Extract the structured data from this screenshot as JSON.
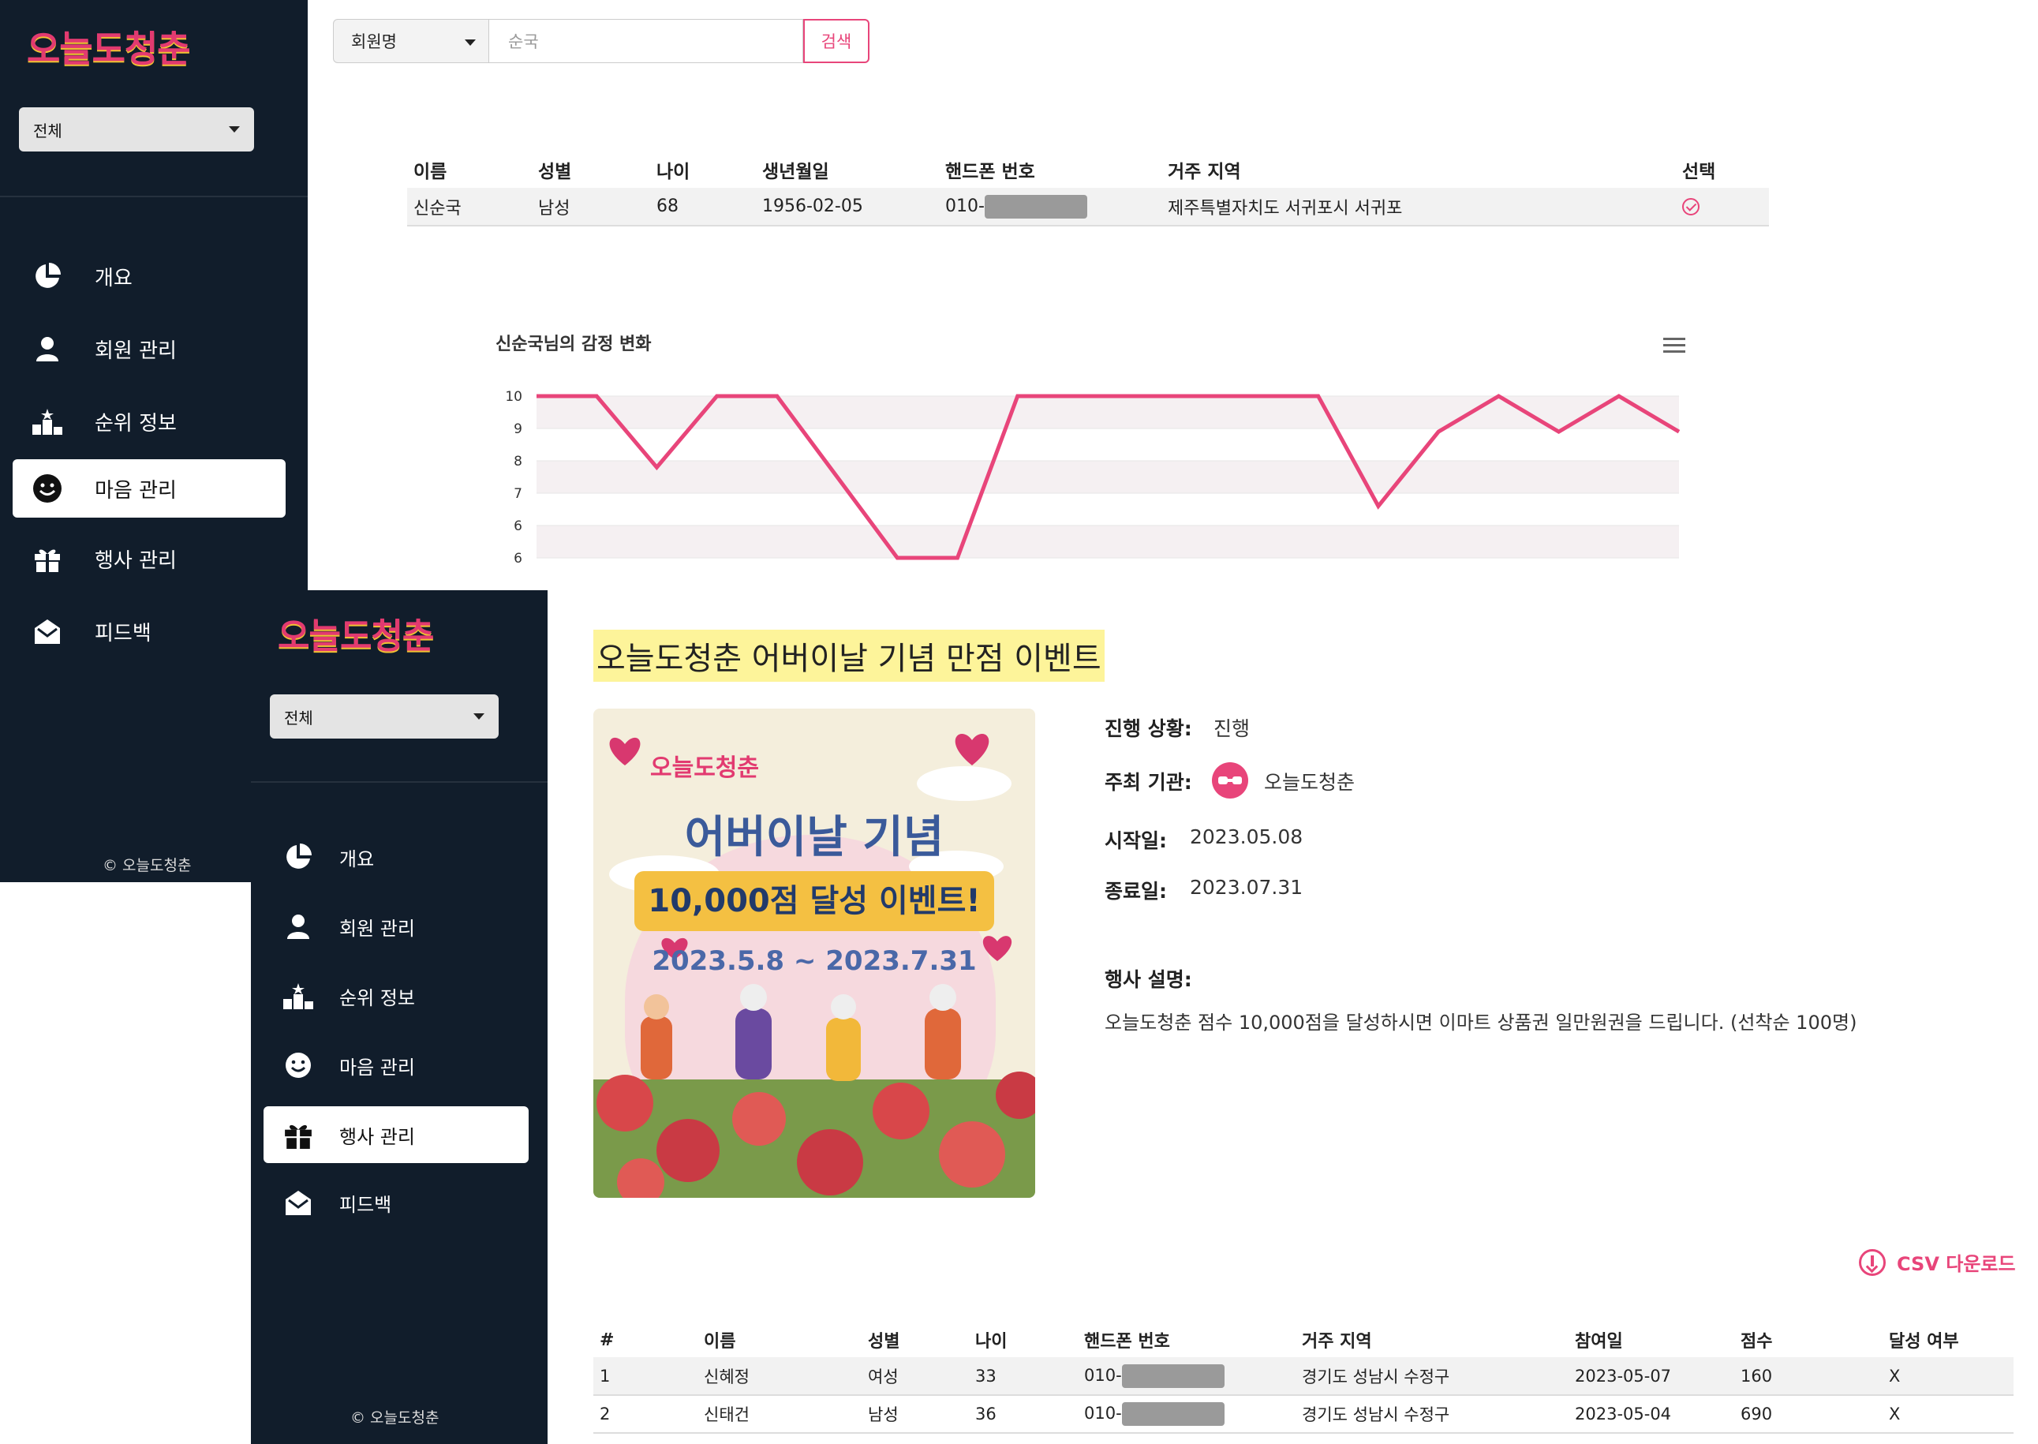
{
  "brand": {
    "logo_text": "오늘도청춘",
    "footer": "© 오늘도청춘",
    "accent": "#e8457a"
  },
  "sidebar": {
    "filter_value": "전체",
    "items": [
      {
        "label": "개요",
        "icon": "pie-chart-icon"
      },
      {
        "label": "회원 관리",
        "icon": "user-icon"
      },
      {
        "label": "순위 정보",
        "icon": "podium-icon"
      },
      {
        "label": "마음 관리",
        "icon": "smile-icon"
      },
      {
        "label": "행사 관리",
        "icon": "gift-icon"
      },
      {
        "label": "피드백",
        "icon": "envelope-open-icon"
      }
    ],
    "active_back": "마음 관리",
    "active_front": "행사 관리"
  },
  "search": {
    "type_value": "회원명",
    "query": "순국",
    "button_label": "검색"
  },
  "member_table": {
    "headers": [
      "이름",
      "성별",
      "나이",
      "생년월일",
      "핸드폰 번호",
      "거주 지역",
      "선택"
    ],
    "row": {
      "name": "신순국",
      "gender": "남성",
      "age": "68",
      "birth": "1956-02-05",
      "phone_prefix": "010-",
      "region": "제주특별자치도 서귀포시 서귀포"
    }
  },
  "chart_data": {
    "type": "line",
    "title": "신순국님의 감정 변화",
    "y_ticks": [
      "10",
      "9",
      "8",
      "7",
      "6",
      "6"
    ],
    "ylim": [
      5.5,
      10
    ],
    "series": [
      {
        "values": [
          10,
          10,
          7.8,
          10,
          10,
          7.5,
          5,
          5,
          10,
          10,
          10,
          10,
          10,
          10,
          6.6,
          8.9,
          10,
          8.9,
          10,
          8.9
        ]
      }
    ],
    "line_color": "#e8457a",
    "grid": true
  },
  "event": {
    "title": "오늘도청춘 어버이날 기념 만점 이벤트",
    "status_label": "진행 상황:",
    "status_value": "진행",
    "host_label": "주최 기관:",
    "host_value": "오늘도청춘",
    "start_label": "시작일:",
    "start_value": "2023.05.08",
    "end_label": "종료일:",
    "end_value": "2023.07.31",
    "desc_label": "행사 설명:",
    "desc_value": "오늘도청춘 점수 10,000점을 달성하시면 이마트 상품권 일만원권을 드립니다. (선착순 100명)",
    "poster": {
      "logo": "오늘도청춘",
      "heading": "어버이날 기념",
      "badge": "10,000점 달성 이벤트!",
      "dates": "2023.5.8 ~ 2023.7.31"
    }
  },
  "csv_button": "CSV 다운로드",
  "participants": {
    "headers": [
      "#",
      "이름",
      "성별",
      "나이",
      "핸드폰 번호",
      "거주 지역",
      "참여일",
      "점수",
      "달성 여부"
    ],
    "rows": [
      {
        "no": "1",
        "name": "신혜정",
        "gender": "여성",
        "age": "33",
        "phone_prefix": "010-",
        "region": "경기도 성남시 수정구",
        "date": "2023-05-07",
        "score": "160",
        "achieved": "X"
      },
      {
        "no": "2",
        "name": "신태건",
        "gender": "남성",
        "age": "36",
        "phone_prefix": "010-",
        "region": "경기도 성남시 수정구",
        "date": "2023-05-04",
        "score": "690",
        "achieved": "X"
      }
    ]
  }
}
